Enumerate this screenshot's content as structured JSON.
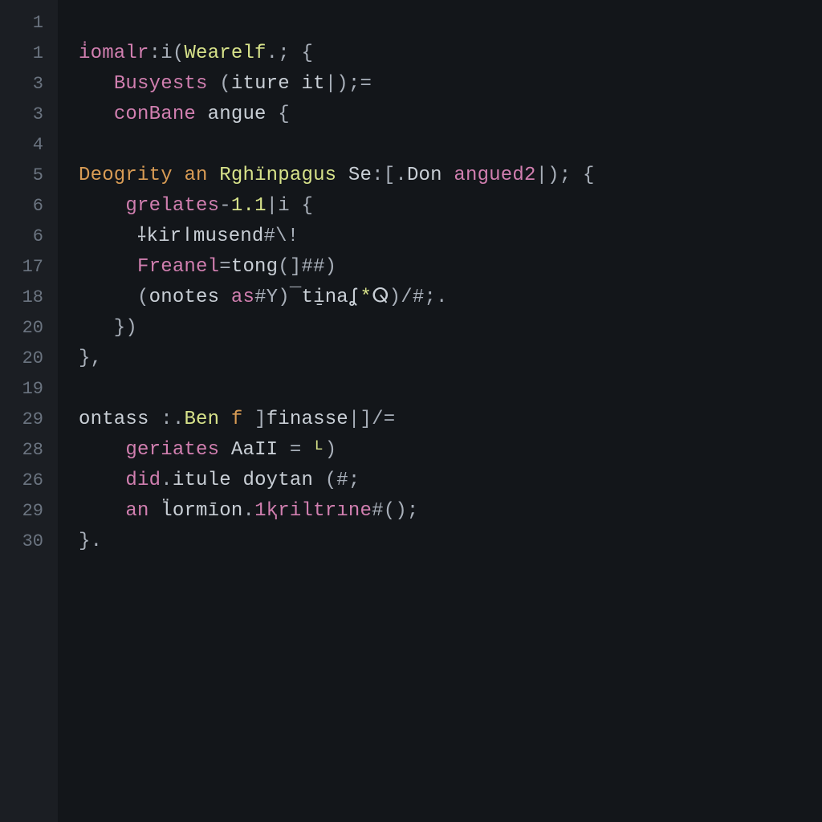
{
  "gutter": [
    "1",
    "1",
    "3",
    "3",
    "4",
    "5",
    "6",
    "6",
    "17",
    "18",
    "20",
    "20",
    "19",
    "29",
    "28",
    "26",
    "29",
    "30"
  ],
  "lines": {
    "l1": {
      "a": ""
    },
    "l2": {
      "a": "i̇omalr",
      "b": ":i(",
      "c": "Wearelf",
      "d": ".; {"
    },
    "l3": {
      "a": "   ",
      "b": "Busyests",
      "c": " (",
      "d": "iture it",
      "e": "|);="
    },
    "l4": {
      "a": "   ",
      "b": "conBane",
      "c": " ",
      "d": "angue",
      "e": " {"
    },
    "l5": {
      "a": ""
    },
    "l6": {
      "a": "Deogrity",
      "b": " ",
      "c": "an",
      "d": " ",
      "e": "Rghïnpagus",
      "f": " ",
      "g": "Se",
      "h": ":[.",
      "i": "Don",
      "j": " ",
      "k": "angued2",
      "l": "|); {"
    },
    "l7": {
      "a": "    ",
      "b": "grelates",
      "c": "-",
      "d": "1.1",
      "e": "|i {"
    },
    "l8": {
      "a": "     ",
      "b": "⸸kirǀmusend",
      "c": "#\\!"
    },
    "l9": {
      "a": "     ",
      "b": "Freanel",
      "c": "=",
      "d": "tong",
      "e": "(]##)"
    },
    "l10": {
      "a": "     (",
      "b": "onotes",
      "c": " ",
      "d": "as",
      "e": "#Y)¯",
      "f": "ti̱naʆ",
      "g": "*",
      "h": "ⵕ",
      "i": ")/#;."
    },
    "l11": {
      "a": "   })"
    },
    "l12": {
      "a": "},"
    },
    "l13": {
      "a": ""
    },
    "l14": {
      "a": "ontass",
      "b": " :.",
      "c": "Ben",
      "d": " ",
      "e": "f",
      "f": " ]",
      "g": "finasse",
      "h": "|]/="
    },
    "l15": {
      "a": "    ",
      "b": "geriates",
      "c": " ",
      "d": "AaII",
      "e": " = ",
      "f": "ᴸ",
      "g": ")"
    },
    "l16": {
      "a": "    ",
      "b": "did",
      "c": ".",
      "d": "itule",
      "e": " ",
      "f": "doytan",
      "g": " (#;"
    },
    "l17": {
      "a": "    ",
      "b": "an",
      "c": " ",
      "d": "l̈ormīon",
      "e": ".",
      "f": "1ⱪriltrıne",
      "g": "#();"
    },
    "l18": {
      "a": "}."
    }
  }
}
